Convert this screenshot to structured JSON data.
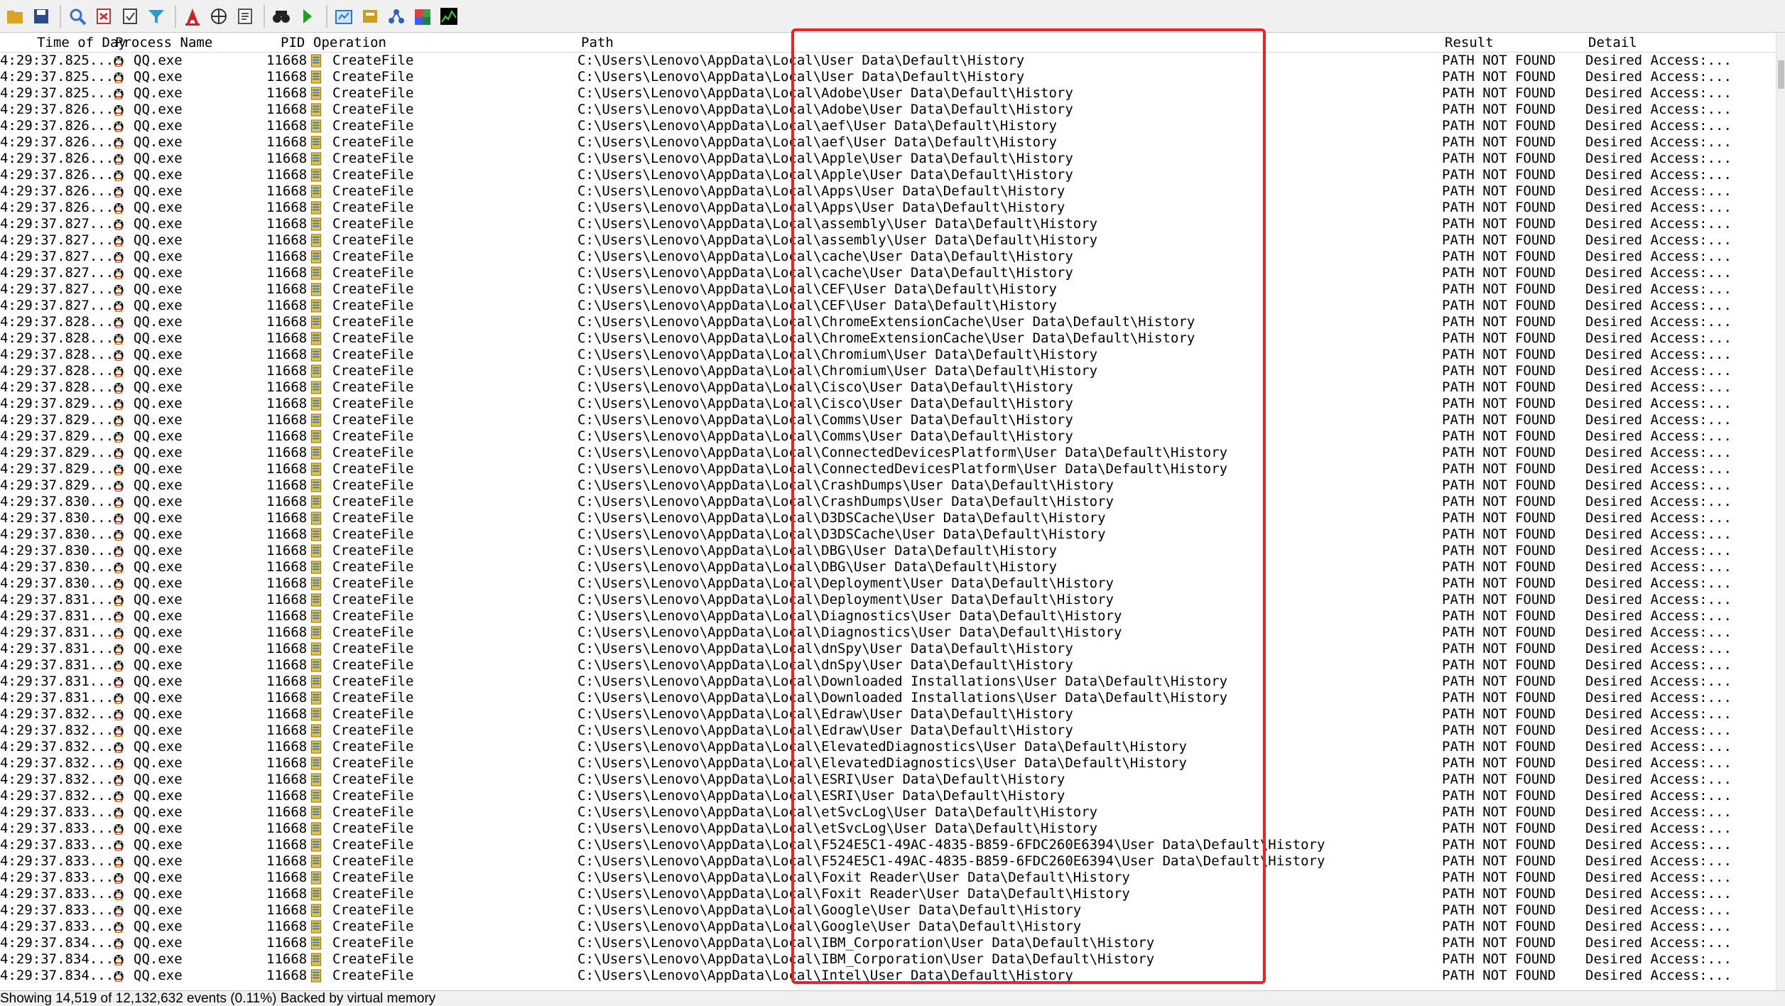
{
  "toolbar": {
    "buttons": [
      {
        "name": "open-icon",
        "color": "#d9a520"
      },
      {
        "name": "save-icon",
        "color": "#2b4a8c"
      },
      {
        "name": "find-icon",
        "color": "#3a6fc9"
      },
      {
        "name": "registry-icon",
        "color": "#c83232"
      },
      {
        "name": "autoscroll-icon",
        "color": "#444444"
      },
      {
        "name": "filter-icon",
        "color": "#2a9ad0"
      },
      {
        "name": "highlight-icon",
        "color": "#d02020"
      },
      {
        "name": "network-icon",
        "color": "#333333"
      },
      {
        "name": "properties-icon",
        "color": "#555555"
      },
      {
        "name": "binoculars-icon",
        "color": "#222222"
      },
      {
        "name": "jump-icon",
        "color": "#20a020"
      },
      {
        "name": "show-registry-icon",
        "color": "#2a7ac0"
      },
      {
        "name": "show-filesystem-icon",
        "color": "#c8a020"
      },
      {
        "name": "show-network-icon",
        "color": "#3060c0"
      },
      {
        "name": "show-process-icon",
        "color": "#208040"
      },
      {
        "name": "show-profiling-icon",
        "color": "#107010"
      }
    ]
  },
  "columns": {
    "time": "Time of Day",
    "process": "Process Name",
    "pid": "PID",
    "operation": "Operation",
    "path": "Path",
    "result": "Result",
    "detail": "Detail"
  },
  "row_defaults": {
    "process": "QQ.exe",
    "pid": "11668",
    "operation": "CreateFile",
    "result": "PATH NOT FOUND",
    "detail": "Desired Access:..."
  },
  "rows": [
    {
      "time": "4:29:37.825...",
      "path": "C:\\Users\\Lenovo\\AppData\\Local\\User Data\\Default\\History"
    },
    {
      "time": "4:29:37.825...",
      "path": "C:\\Users\\Lenovo\\AppData\\Local\\User Data\\Default\\History"
    },
    {
      "time": "4:29:37.825...",
      "path": "C:\\Users\\Lenovo\\AppData\\Local\\Adobe\\User Data\\Default\\History"
    },
    {
      "time": "4:29:37.826...",
      "path": "C:\\Users\\Lenovo\\AppData\\Local\\Adobe\\User Data\\Default\\History"
    },
    {
      "time": "4:29:37.826...",
      "path": "C:\\Users\\Lenovo\\AppData\\Local\\aef\\User Data\\Default\\History"
    },
    {
      "time": "4:29:37.826...",
      "path": "C:\\Users\\Lenovo\\AppData\\Local\\aef\\User Data\\Default\\History"
    },
    {
      "time": "4:29:37.826...",
      "path": "C:\\Users\\Lenovo\\AppData\\Local\\Apple\\User Data\\Default\\History"
    },
    {
      "time": "4:29:37.826...",
      "path": "C:\\Users\\Lenovo\\AppData\\Local\\Apple\\User Data\\Default\\History"
    },
    {
      "time": "4:29:37.826...",
      "path": "C:\\Users\\Lenovo\\AppData\\Local\\Apps\\User Data\\Default\\History"
    },
    {
      "time": "4:29:37.826...",
      "path": "C:\\Users\\Lenovo\\AppData\\Local\\Apps\\User Data\\Default\\History"
    },
    {
      "time": "4:29:37.827...",
      "path": "C:\\Users\\Lenovo\\AppData\\Local\\assembly\\User Data\\Default\\History"
    },
    {
      "time": "4:29:37.827...",
      "path": "C:\\Users\\Lenovo\\AppData\\Local\\assembly\\User Data\\Default\\History"
    },
    {
      "time": "4:29:37.827...",
      "path": "C:\\Users\\Lenovo\\AppData\\Local\\cache\\User Data\\Default\\History"
    },
    {
      "time": "4:29:37.827...",
      "path": "C:\\Users\\Lenovo\\AppData\\Local\\cache\\User Data\\Default\\History"
    },
    {
      "time": "4:29:37.827...",
      "path": "C:\\Users\\Lenovo\\AppData\\Local\\CEF\\User Data\\Default\\History"
    },
    {
      "time": "4:29:37.827...",
      "path": "C:\\Users\\Lenovo\\AppData\\Local\\CEF\\User Data\\Default\\History"
    },
    {
      "time": "4:29:37.828...",
      "path": "C:\\Users\\Lenovo\\AppData\\Local\\ChromeExtensionCache\\User Data\\Default\\History"
    },
    {
      "time": "4:29:37.828...",
      "path": "C:\\Users\\Lenovo\\AppData\\Local\\ChromeExtensionCache\\User Data\\Default\\History"
    },
    {
      "time": "4:29:37.828...",
      "path": "C:\\Users\\Lenovo\\AppData\\Local\\Chromium\\User Data\\Default\\History"
    },
    {
      "time": "4:29:37.828...",
      "path": "C:\\Users\\Lenovo\\AppData\\Local\\Chromium\\User Data\\Default\\History"
    },
    {
      "time": "4:29:37.828...",
      "path": "C:\\Users\\Lenovo\\AppData\\Local\\Cisco\\User Data\\Default\\History"
    },
    {
      "time": "4:29:37.829...",
      "path": "C:\\Users\\Lenovo\\AppData\\Local\\Cisco\\User Data\\Default\\History"
    },
    {
      "time": "4:29:37.829...",
      "path": "C:\\Users\\Lenovo\\AppData\\Local\\Comms\\User Data\\Default\\History"
    },
    {
      "time": "4:29:37.829...",
      "path": "C:\\Users\\Lenovo\\AppData\\Local\\Comms\\User Data\\Default\\History"
    },
    {
      "time": "4:29:37.829...",
      "path": "C:\\Users\\Lenovo\\AppData\\Local\\ConnectedDevicesPlatform\\User Data\\Default\\History"
    },
    {
      "time": "4:29:37.829...",
      "path": "C:\\Users\\Lenovo\\AppData\\Local\\ConnectedDevicesPlatform\\User Data\\Default\\History"
    },
    {
      "time": "4:29:37.829...",
      "path": "C:\\Users\\Lenovo\\AppData\\Local\\CrashDumps\\User Data\\Default\\History"
    },
    {
      "time": "4:29:37.830...",
      "path": "C:\\Users\\Lenovo\\AppData\\Local\\CrashDumps\\User Data\\Default\\History"
    },
    {
      "time": "4:29:37.830...",
      "path": "C:\\Users\\Lenovo\\AppData\\Local\\D3DSCache\\User Data\\Default\\History"
    },
    {
      "time": "4:29:37.830...",
      "path": "C:\\Users\\Lenovo\\AppData\\Local\\D3DSCache\\User Data\\Default\\History"
    },
    {
      "time": "4:29:37.830...",
      "path": "C:\\Users\\Lenovo\\AppData\\Local\\DBG\\User Data\\Default\\History"
    },
    {
      "time": "4:29:37.830...",
      "path": "C:\\Users\\Lenovo\\AppData\\Local\\DBG\\User Data\\Default\\History"
    },
    {
      "time": "4:29:37.830...",
      "path": "C:\\Users\\Lenovo\\AppData\\Local\\Deployment\\User Data\\Default\\History"
    },
    {
      "time": "4:29:37.831...",
      "path": "C:\\Users\\Lenovo\\AppData\\Local\\Deployment\\User Data\\Default\\History"
    },
    {
      "time": "4:29:37.831...",
      "path": "C:\\Users\\Lenovo\\AppData\\Local\\Diagnostics\\User Data\\Default\\History"
    },
    {
      "time": "4:29:37.831...",
      "path": "C:\\Users\\Lenovo\\AppData\\Local\\Diagnostics\\User Data\\Default\\History"
    },
    {
      "time": "4:29:37.831...",
      "path": "C:\\Users\\Lenovo\\AppData\\Local\\dnSpy\\User Data\\Default\\History"
    },
    {
      "time": "4:29:37.831...",
      "path": "C:\\Users\\Lenovo\\AppData\\Local\\dnSpy\\User Data\\Default\\History"
    },
    {
      "time": "4:29:37.831...",
      "path": "C:\\Users\\Lenovo\\AppData\\Local\\Downloaded Installations\\User Data\\Default\\History"
    },
    {
      "time": "4:29:37.831...",
      "path": "C:\\Users\\Lenovo\\AppData\\Local\\Downloaded Installations\\User Data\\Default\\History"
    },
    {
      "time": "4:29:37.832...",
      "path": "C:\\Users\\Lenovo\\AppData\\Local\\Edraw\\User Data\\Default\\History"
    },
    {
      "time": "4:29:37.832...",
      "path": "C:\\Users\\Lenovo\\AppData\\Local\\Edraw\\User Data\\Default\\History"
    },
    {
      "time": "4:29:37.832...",
      "path": "C:\\Users\\Lenovo\\AppData\\Local\\ElevatedDiagnostics\\User Data\\Default\\History"
    },
    {
      "time": "4:29:37.832...",
      "path": "C:\\Users\\Lenovo\\AppData\\Local\\ElevatedDiagnostics\\User Data\\Default\\History"
    },
    {
      "time": "4:29:37.832...",
      "path": "C:\\Users\\Lenovo\\AppData\\Local\\ESRI\\User Data\\Default\\History"
    },
    {
      "time": "4:29:37.832...",
      "path": "C:\\Users\\Lenovo\\AppData\\Local\\ESRI\\User Data\\Default\\History"
    },
    {
      "time": "4:29:37.833...",
      "path": "C:\\Users\\Lenovo\\AppData\\Local\\etSvcLog\\User Data\\Default\\History"
    },
    {
      "time": "4:29:37.833...",
      "path": "C:\\Users\\Lenovo\\AppData\\Local\\etSvcLog\\User Data\\Default\\History"
    },
    {
      "time": "4:29:37.833...",
      "path": "C:\\Users\\Lenovo\\AppData\\Local\\F524E5C1-49AC-4835-B859-6FDC260E6394\\User Data\\Default\\History"
    },
    {
      "time": "4:29:37.833...",
      "path": "C:\\Users\\Lenovo\\AppData\\Local\\F524E5C1-49AC-4835-B859-6FDC260E6394\\User Data\\Default\\History"
    },
    {
      "time": "4:29:37.833...",
      "path": "C:\\Users\\Lenovo\\AppData\\Local\\Foxit Reader\\User Data\\Default\\History"
    },
    {
      "time": "4:29:37.833...",
      "path": "C:\\Users\\Lenovo\\AppData\\Local\\Foxit Reader\\User Data\\Default\\History"
    },
    {
      "time": "4:29:37.833...",
      "path": "C:\\Users\\Lenovo\\AppData\\Local\\Google\\User Data\\Default\\History"
    },
    {
      "time": "4:29:37.833...",
      "path": "C:\\Users\\Lenovo\\AppData\\Local\\Google\\User Data\\Default\\History"
    },
    {
      "time": "4:29:37.834...",
      "path": "C:\\Users\\Lenovo\\AppData\\Local\\IBM_Corporation\\User Data\\Default\\History"
    },
    {
      "time": "4:29:37.834...",
      "path": "C:\\Users\\Lenovo\\AppData\\Local\\IBM_Corporation\\User Data\\Default\\History"
    },
    {
      "time": "4:29:37.834...",
      "path": "C:\\Users\\Lenovo\\AppData\\Local\\Intel\\User Data\\Default\\History"
    }
  ],
  "status": {
    "text": "Showing 14,519 of 12,132,632 events (0.11%)    Backed by virtual memory"
  },
  "colors": {
    "highlight_border": "#e8242a",
    "toolbar_bg": "#f0f0f0"
  }
}
